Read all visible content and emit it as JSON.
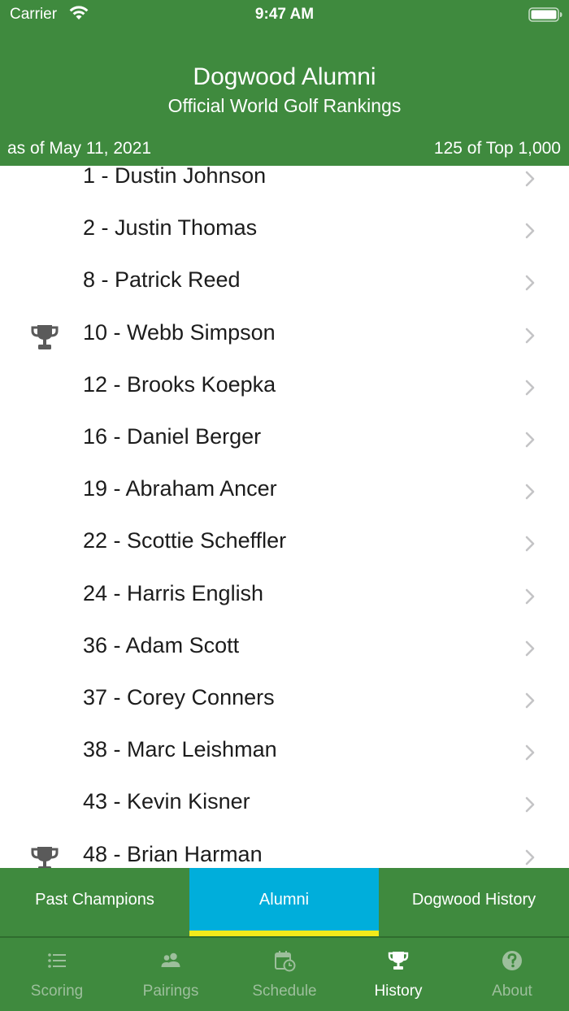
{
  "status_bar": {
    "carrier": "Carrier",
    "time": "9:47 AM"
  },
  "header": {
    "title": "Dogwood Alumni",
    "subtitle": "Official World Golf Rankings",
    "as_of": "as of May 11, 2021",
    "count": "125 of Top 1,000"
  },
  "rankings": [
    {
      "label": "1 - Dustin Johnson",
      "champion": false
    },
    {
      "label": "2 - Justin Thomas",
      "champion": false
    },
    {
      "label": "8 - Patrick Reed",
      "champion": false
    },
    {
      "label": "10 - Webb Simpson",
      "champion": true
    },
    {
      "label": "12 - Brooks Koepka",
      "champion": false
    },
    {
      "label": "16 - Daniel Berger",
      "champion": false
    },
    {
      "label": "19 - Abraham Ancer",
      "champion": false
    },
    {
      "label": "22 - Scottie Scheffler",
      "champion": false
    },
    {
      "label": "24 - Harris English",
      "champion": false
    },
    {
      "label": "36 - Adam Scott",
      "champion": false
    },
    {
      "label": "37 - Corey Conners",
      "champion": false
    },
    {
      "label": "38 - Marc Leishman",
      "champion": false
    },
    {
      "label": "43 - Kevin Kisner",
      "champion": false
    },
    {
      "label": "48 - Brian Harman",
      "champion": true
    }
  ],
  "segments": {
    "past_champions": "Past Champions",
    "alumni": "Alumni",
    "dogwood_history": "Dogwood History",
    "selected": "Alumni"
  },
  "tabs": {
    "scoring": "Scoring",
    "pairings": "Pairings",
    "schedule": "Schedule",
    "history": "History",
    "about": "About",
    "selected": "History"
  },
  "colors": {
    "brand_green": "#3f8a3e",
    "segment_active": "#00aedb",
    "segment_underline": "#f2ea1b",
    "tab_inactive": "#9dbf9c"
  }
}
